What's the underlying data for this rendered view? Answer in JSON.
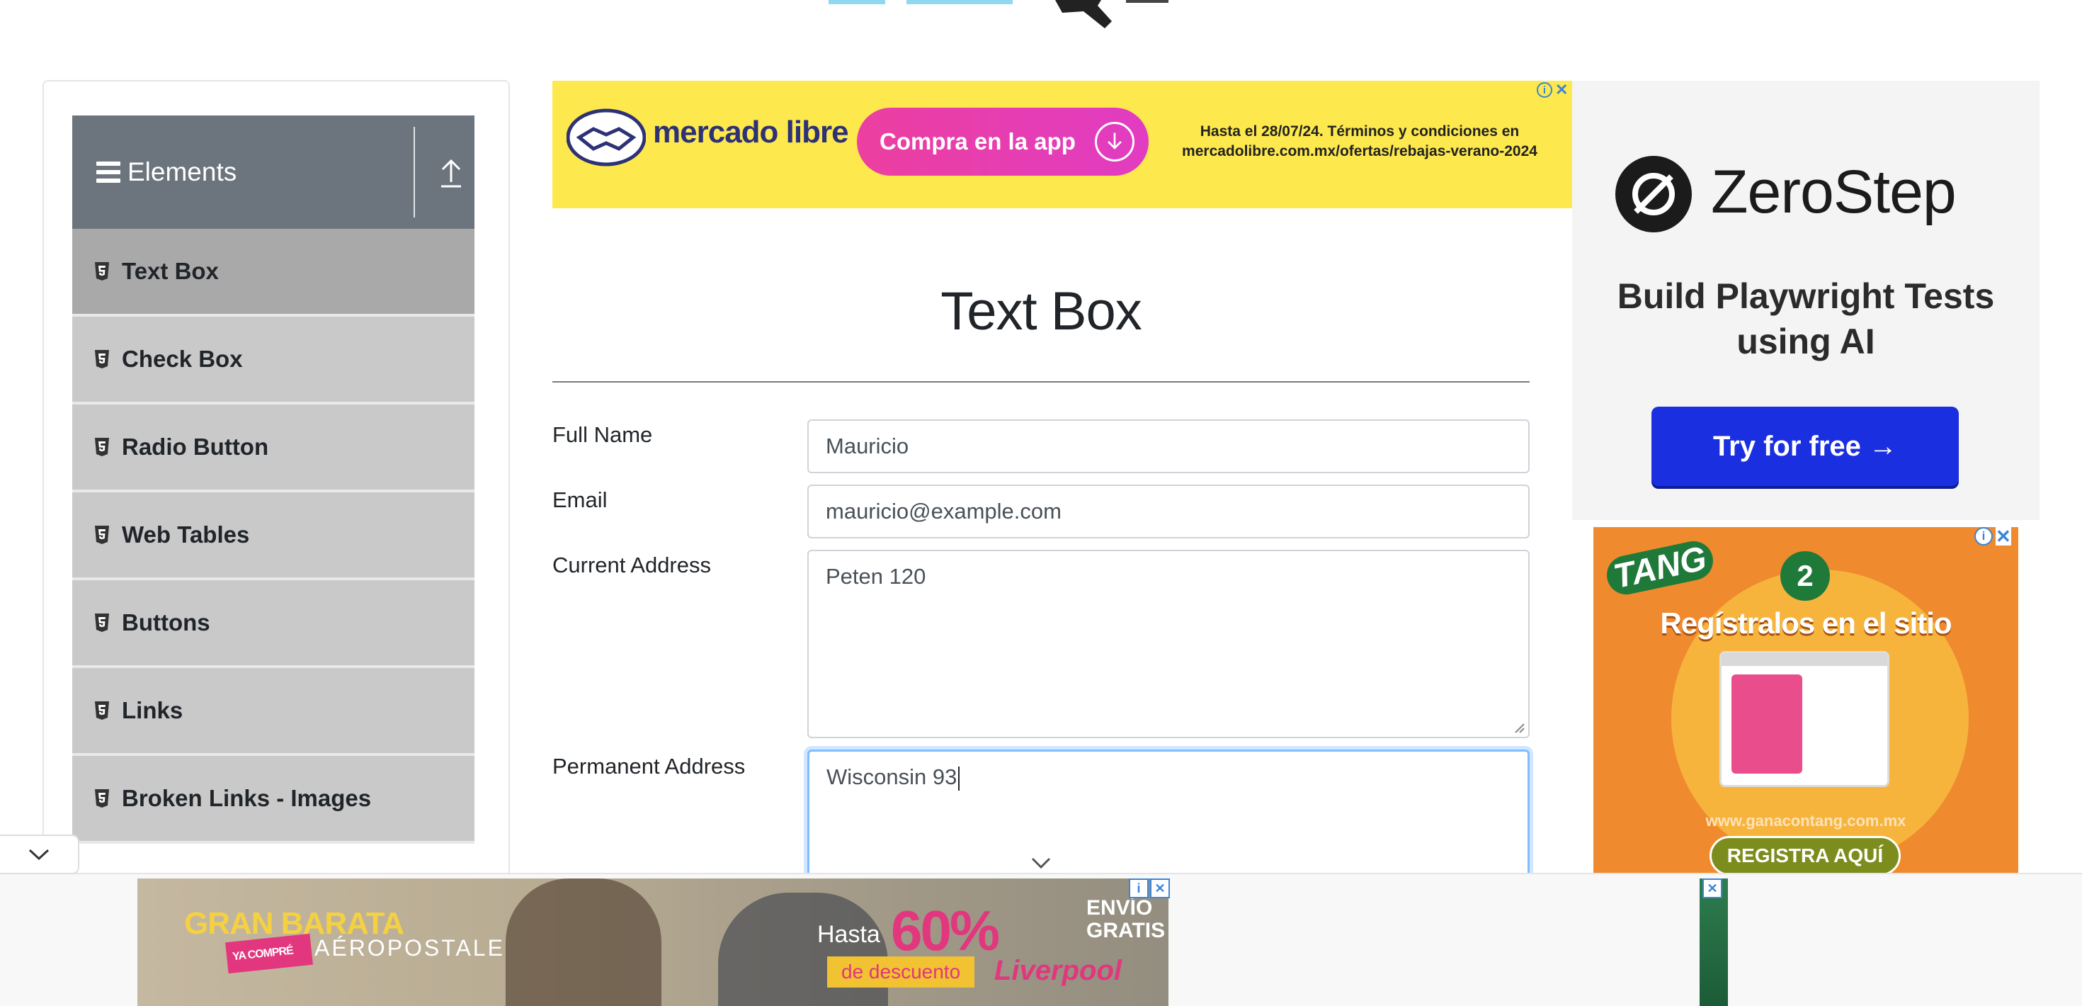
{
  "sidebar": {
    "group_title": "Elements",
    "items": [
      {
        "label": "Text Box"
      },
      {
        "label": "Check Box"
      },
      {
        "label": "Radio Button"
      },
      {
        "label": "Web Tables"
      },
      {
        "label": "Buttons"
      },
      {
        "label": "Links"
      },
      {
        "label": "Broken Links - Images"
      }
    ],
    "active_item": "Text Box"
  },
  "main": {
    "title": "Text Box",
    "fields": [
      {
        "label": "Full Name",
        "value": "Mauricio"
      },
      {
        "label": "Email",
        "value": "mauricio@example.com"
      },
      {
        "label": "Current Address",
        "value": "Peten 120"
      },
      {
        "label": "Permanent Address",
        "value": "Wisconsin 93"
      }
    ]
  },
  "ads": {
    "top_banner": {
      "brand": "mercado libre",
      "cta": "Compra en la app",
      "terms": "Hasta el 28/07/24. Términos y condiciones en mercadolibre.com.mx/ofertas/rebajas-verano-2024"
    },
    "right_top": {
      "brand": "ZeroStep",
      "tagline": "Build Playwright Tests using AI",
      "cta": "Try for free →"
    },
    "right_bottom": {
      "brand": "TANG",
      "step": "2",
      "headline": "Regístralos en el sitio",
      "url": "www.ganacontang.com.mx",
      "cta": "REGISTRA AQUÍ"
    },
    "bottom_banner": {
      "promo": "GRAN BARATA",
      "promo_sub": "YA COMPRÉ",
      "brand": "AÉROPOSTALE",
      "hasta": "Hasta",
      "percent": "60%",
      "discount": "de descuento",
      "shipping": "ENVÍO GRATIS",
      "store": "Liverpool"
    }
  },
  "colors": {
    "sidebar_header": "#6c757d",
    "menu_item": "#c9c9c9",
    "menu_item_active": "#a9a9a9",
    "focus_border": "#80bdff",
    "mercado_yellow": "#fde84d",
    "zerostep_blue": "#1a2fe0"
  }
}
